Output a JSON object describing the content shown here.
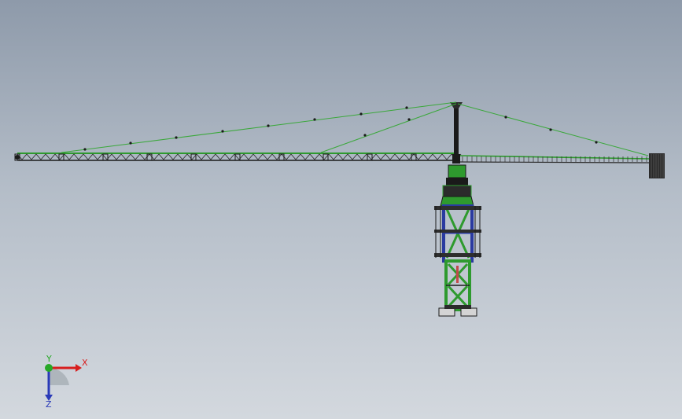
{
  "viewport": {
    "bg_top": "#8e9aaa",
    "bg_bottom": "#d3d8de"
  },
  "model": {
    "structure_color": "#2e9a2e",
    "cable_color": "#3aa83a",
    "steel_color": "#1a1a1a",
    "mast_color": "#2a3aa0"
  },
  "triad": {
    "x_label": "X",
    "y_label": "Y",
    "z_label": "Z",
    "x_color": "#d81e1e",
    "y_color": "#27a827",
    "z_color": "#2a3ab8"
  }
}
